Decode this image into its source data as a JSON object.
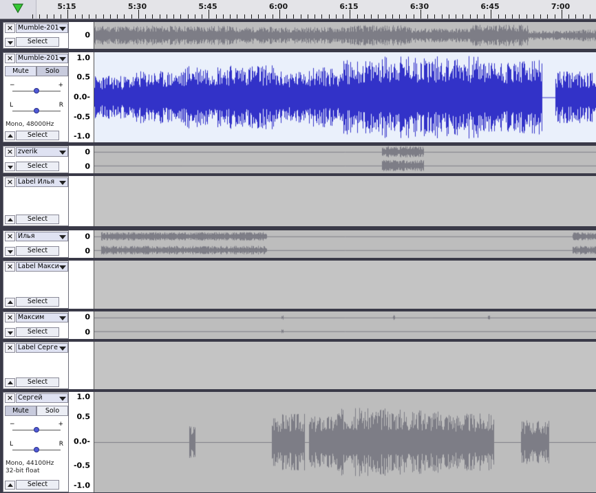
{
  "ruler": {
    "ticks": [
      "5:15",
      "5:30",
      "5:45",
      "6:00",
      "6:15",
      "6:30",
      "6:45",
      "7:00"
    ]
  },
  "tracks": [
    {
      "id": "t1",
      "name": "Mumble-201",
      "select": "Select",
      "ruler": [
        "0"
      ],
      "kind": "wave-collapsed",
      "color": "#7d7d86"
    },
    {
      "id": "t2",
      "name": "Mumble-201",
      "select": "Select",
      "mute": "Mute",
      "solo": "Solo",
      "gain_min": "−",
      "gain_max": "+",
      "pan_left": "L",
      "pan_right": "R",
      "info": "Mono, 48000Hz",
      "ruler": [
        "1.0",
        "0.5",
        "0.0-",
        "-0.5",
        "-1.0"
      ],
      "kind": "wave-selected",
      "color": "#3232c8"
    },
    {
      "id": "t3",
      "name": "zverik",
      "select": "Select",
      "ruler": [
        "0",
        "0"
      ],
      "kind": "stereo"
    },
    {
      "id": "t4",
      "name": "Label Илья",
      "select": "Select",
      "kind": "label"
    },
    {
      "id": "t5",
      "name": "Илья",
      "select": "Select",
      "ruler": [
        "0",
        "0"
      ],
      "kind": "stereo"
    },
    {
      "id": "t6",
      "name": "Label Макси",
      "select": "Select",
      "kind": "label"
    },
    {
      "id": "t7",
      "name": "Максим",
      "select": "Select",
      "ruler": [
        "0",
        "0"
      ],
      "kind": "stereo"
    },
    {
      "id": "t8",
      "name": "Label Серге",
      "select": "Select",
      "kind": "label"
    },
    {
      "id": "t9",
      "name": "Сергей",
      "select": "Select",
      "mute": "Mute",
      "solo": "Solo",
      "gain_min": "−",
      "gain_max": "+",
      "pan_left": "L",
      "pan_right": "R",
      "info": "Mono, 44100Hz\n32-bit float",
      "ruler": [
        "1.0",
        "0.5",
        "0.0-",
        "-0.5",
        "-1.0"
      ],
      "kind": "wave-full",
      "color": "#7d7d86"
    }
  ],
  "colors": {
    "selected_wave": "#3232c8",
    "wave": "#7d7d86",
    "wave_bg": "#bdbdbd",
    "selected_bg": "#eaf0fb",
    "label_bg": "#c4c4c4"
  }
}
